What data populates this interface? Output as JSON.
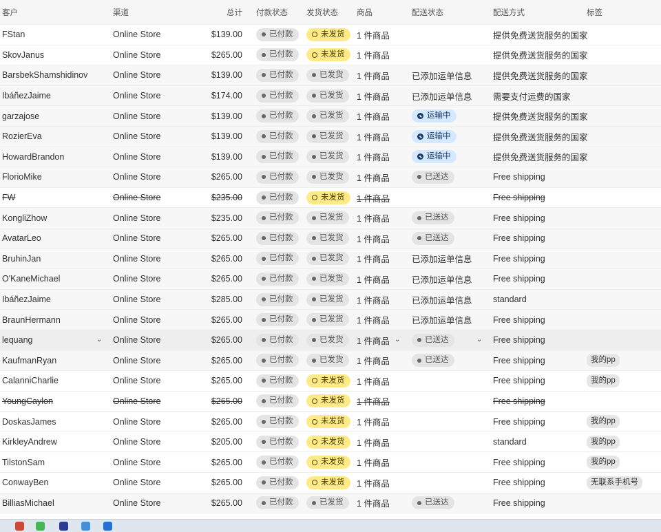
{
  "headers": {
    "customer": "客户",
    "channel": "渠道",
    "total": "总计",
    "payment": "付款状态",
    "fulfillment": "发货状态",
    "items": "商品",
    "delivery_status": "配送状态",
    "delivery_method": "配送方式",
    "tags": "标签"
  },
  "rows": [
    {
      "customer": "FStan",
      "channel": "Online Store",
      "total": "$139.00",
      "payment": "已付款",
      "fulfillment": "未发货",
      "items": "1 件商品",
      "delivery": "",
      "method": "提供免费送货服务的国家",
      "tag": ""
    },
    {
      "customer": "SkovJanus",
      "channel": "Online Store",
      "total": "$265.00",
      "payment": "已付款",
      "fulfillment": "未发货",
      "items": "1 件商品",
      "delivery": "",
      "method": "提供免费送货服务的国家",
      "tag": ""
    },
    {
      "customer": "BarsbekShamshidinov",
      "channel": "Online Store",
      "total": "$139.00",
      "payment": "已付款",
      "fulfillment": "已发货",
      "items": "1 件商品",
      "delivery": "已添加运单信息",
      "method": "提供免费送货服务的国家",
      "tag": ""
    },
    {
      "customer": "IbáñezJaime",
      "channel": "Online Store",
      "total": "$174.00",
      "payment": "已付款",
      "fulfillment": "已发货",
      "items": "1 件商品",
      "delivery": "已添加运单信息",
      "method": "需要支付运费的国家",
      "tag": ""
    },
    {
      "customer": "garzajose",
      "channel": "Online Store",
      "total": "$139.00",
      "payment": "已付款",
      "fulfillment": "已发货",
      "items": "1 件商品",
      "delivery": "运输中",
      "method": "提供免费送货服务的国家",
      "tag": ""
    },
    {
      "customer": "RozierEva",
      "channel": "Online Store",
      "total": "$139.00",
      "payment": "已付款",
      "fulfillment": "已发货",
      "items": "1 件商品",
      "delivery": "运输中",
      "method": "提供免费送货服务的国家",
      "tag": ""
    },
    {
      "customer": "HowardBrandon",
      "channel": "Online Store",
      "total": "$139.00",
      "payment": "已付款",
      "fulfillment": "已发货",
      "items": "1 件商品",
      "delivery": "运输中",
      "method": "提供免费送货服务的国家",
      "tag": ""
    },
    {
      "customer": "FlorioMike",
      "channel": "Online Store",
      "total": "$265.00",
      "payment": "已付款",
      "fulfillment": "已发货",
      "items": "1 件商品",
      "delivery": "已送达",
      "method": "Free shipping",
      "tag": ""
    },
    {
      "customer": "FW",
      "channel": "Online Store",
      "total": "$235.00",
      "payment": "已付款",
      "fulfillment": "未发货",
      "items": "1 件商品",
      "delivery": "",
      "method": "Free shipping",
      "tag": ""
    },
    {
      "customer": "KongliZhow",
      "channel": "Online Store",
      "total": "$235.00",
      "payment": "已付款",
      "fulfillment": "已发货",
      "items": "1 件商品",
      "delivery": "已送达",
      "method": "Free shipping",
      "tag": ""
    },
    {
      "customer": "AvatarLeo",
      "channel": "Online Store",
      "total": "$265.00",
      "payment": "已付款",
      "fulfillment": "已发货",
      "items": "1 件商品",
      "delivery": "已送达",
      "method": "Free shipping",
      "tag": ""
    },
    {
      "customer": "BruhinJan",
      "channel": "Online Store",
      "total": "$265.00",
      "payment": "已付款",
      "fulfillment": "已发货",
      "items": "1 件商品",
      "delivery": "已添加运单信息",
      "method": "Free shipping",
      "tag": ""
    },
    {
      "customer": "O'KaneMichael",
      "channel": "Online Store",
      "total": "$265.00",
      "payment": "已付款",
      "fulfillment": "已发货",
      "items": "1 件商品",
      "delivery": "已添加运单信息",
      "method": "Free shipping",
      "tag": ""
    },
    {
      "customer": "IbáñezJaime",
      "channel": "Online Store",
      "total": "$285.00",
      "payment": "已付款",
      "fulfillment": "已发货",
      "items": "1 件商品",
      "delivery": "已添加运单信息",
      "method": "standard",
      "tag": ""
    },
    {
      "customer": "BraunHermann",
      "channel": "Online Store",
      "total": "$265.00",
      "payment": "已付款",
      "fulfillment": "已发货",
      "items": "1 件商品",
      "delivery": "已添加运单信息",
      "method": "Free shipping",
      "tag": ""
    },
    {
      "customer": "lequang",
      "channel": "Online Store",
      "total": "$265.00",
      "payment": "已付款",
      "fulfillment": "已发货",
      "items": "1 件商品",
      "delivery": "已送达",
      "method": "Free shipping",
      "tag": ""
    },
    {
      "customer": "KaufmanRyan",
      "channel": "Online Store",
      "total": "$265.00",
      "payment": "已付款",
      "fulfillment": "已发货",
      "items": "1 件商品",
      "delivery": "已送达",
      "method": "Free shipping",
      "tag": "我的pp"
    },
    {
      "customer": "CalanniCharlie",
      "channel": "Online Store",
      "total": "$265.00",
      "payment": "已付款",
      "fulfillment": "未发货",
      "items": "1 件商品",
      "delivery": "",
      "method": "Free shipping",
      "tag": "我的pp"
    },
    {
      "customer": "YoungCaylon",
      "channel": "Online Store",
      "total": "$265.00",
      "payment": "已付款",
      "fulfillment": "未发货",
      "items": "1 件商品",
      "delivery": "",
      "method": "Free shipping",
      "tag": ""
    },
    {
      "customer": "DoskasJames",
      "channel": "Online Store",
      "total": "$265.00",
      "payment": "已付款",
      "fulfillment": "未发货",
      "items": "1 件商品",
      "delivery": "",
      "method": "Free shipping",
      "tag": "我的pp"
    },
    {
      "customer": "KirkleyAndrew",
      "channel": "Online Store",
      "total": "$205.00",
      "payment": "已付款",
      "fulfillment": "未发货",
      "items": "1 件商品",
      "delivery": "",
      "method": "standard",
      "tag": "我的pp"
    },
    {
      "customer": "TilstonSam",
      "channel": "Online Store",
      "total": "$265.00",
      "payment": "已付款",
      "fulfillment": "未发货",
      "items": "1 件商品",
      "delivery": "",
      "method": "Free shipping",
      "tag": "我的pp"
    },
    {
      "customer": "ConwayBen",
      "channel": "Online Store",
      "total": "$265.00",
      "payment": "已付款",
      "fulfillment": "未发货",
      "items": "1 件商品",
      "delivery": "",
      "method": "Free shipping",
      "tag": "无联系手机号"
    },
    {
      "customer": "BilliasMichael",
      "channel": "Online Store",
      "total": "$265.00",
      "payment": "已付款",
      "fulfillment": "已发货",
      "items": "1 件商品",
      "delivery": "已送达",
      "method": "Free shipping",
      "tag": ""
    }
  ],
  "row_states": {
    "struck_rows": [
      8,
      18
    ],
    "hovered_row": 15,
    "white_rows": [
      0,
      1,
      8,
      17,
      18,
      19,
      20,
      21,
      22
    ]
  },
  "colors": {
    "unfulfilled_badge": "#ffea8a",
    "in_transit_badge": "#d4e8ff",
    "neutral_badge": "#e4e4e4",
    "row_alt": "#f7f7f7"
  }
}
